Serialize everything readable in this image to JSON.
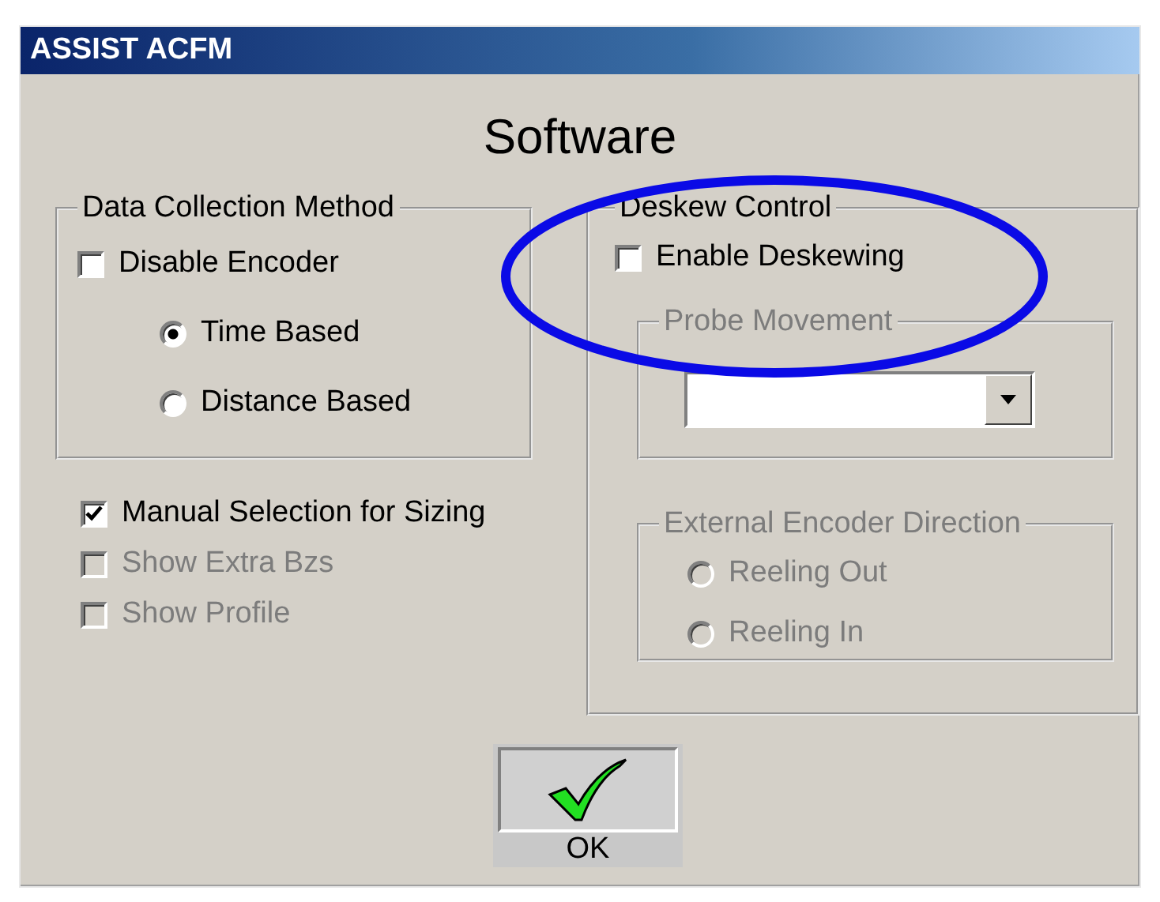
{
  "window": {
    "title": "ASSIST ACFM"
  },
  "heading": "Software",
  "data_collection": {
    "legend": "Data Collection Method",
    "options": [
      {
        "kind": "checkbox",
        "label": "Disable Encoder",
        "checked": false,
        "disabled": false
      },
      {
        "kind": "radio",
        "label": "Time Based",
        "selected": true,
        "disabled": false
      },
      {
        "kind": "radio",
        "label": "Distance Based",
        "selected": false,
        "disabled": false
      }
    ]
  },
  "sizing_options": [
    {
      "label": "Manual Selection for Sizing",
      "checked": true,
      "disabled": false
    },
    {
      "label": "Show Extra Bzs",
      "checked": false,
      "disabled": true
    },
    {
      "label": "Show Profile",
      "checked": false,
      "disabled": true
    }
  ],
  "deskew_control": {
    "legend": "Deskew Control",
    "enable_deskewing": {
      "label": "Enable Deskewing",
      "checked": false,
      "disabled": false
    },
    "probe_movement": {
      "legend": "Probe Movement",
      "disabled": true
    },
    "external_encoder_direction": {
      "legend": "External Encoder Direction",
      "disabled": true,
      "options": [
        {
          "label": "Reeling Out",
          "selected": false,
          "disabled": true
        },
        {
          "label": "Reeling In",
          "selected": false,
          "disabled": true
        }
      ]
    }
  },
  "ok_button": {
    "label": "OK"
  },
  "annotation": {
    "kind": "ellipse"
  }
}
